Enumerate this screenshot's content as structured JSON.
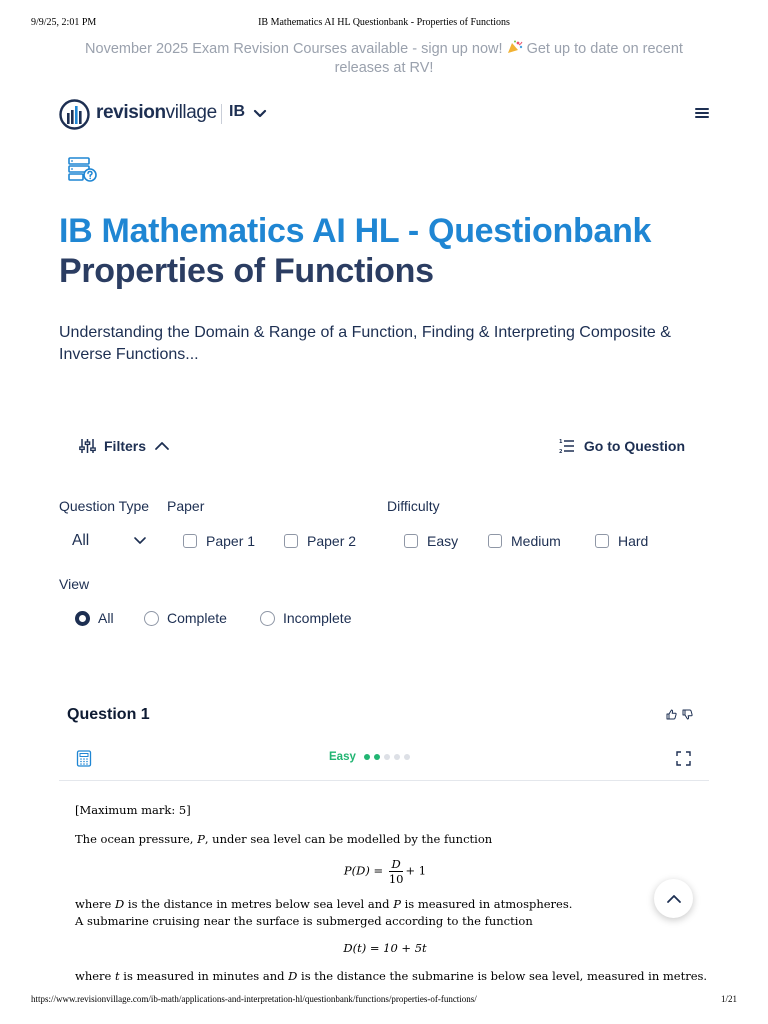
{
  "print": {
    "timestamp": "9/9/25, 2:01 PM",
    "page_title": "IB Mathematics AI HL Questionbank - Properties of Functions",
    "url": "https://www.revisionvillage.com/ib-math/applications-and-interpretation-hl/questionbank/functions/properties-of-functions/",
    "page_number": "1/21"
  },
  "announcement": {
    "text_before": "November 2025 Exam Revision Courses available - sign up now!",
    "emoji_icon": "party-popper-icon",
    "text_after": "Get up to date on recent releases at RV!"
  },
  "nav": {
    "logo_bold": "revision",
    "logo_light": "village",
    "curriculum": "IB",
    "menu_icon": "hamburger-menu-icon"
  },
  "hero": {
    "title_line1": "IB Mathematics AI HL - Questionbank",
    "title_line2": "Properties of Functions",
    "subtitle": "Understanding the Domain & Range of a Function, Finding & Interpreting Composite & Inverse Functions..."
  },
  "toolbar": {
    "filters_label": "Filters",
    "goto_label": "Go to Question"
  },
  "filters": {
    "question_type_label": "Question Type",
    "question_type_value": "All",
    "paper_label": "Paper",
    "paper_options": [
      "Paper 1",
      "Paper 2"
    ],
    "difficulty_label": "Difficulty",
    "difficulty_options": [
      "Easy",
      "Medium",
      "Hard"
    ],
    "view_label": "View",
    "view_options": [
      "All",
      "Complete",
      "Incomplete"
    ],
    "view_selected": "All"
  },
  "question": {
    "title": "Question 1",
    "difficulty_label": "Easy",
    "difficulty_level": 2,
    "difficulty_max": 5,
    "accent_color": "#22b573",
    "body": {
      "max_mark": "[Maximum mark: 5]",
      "intro_a": "The ocean pressure, ",
      "intro_var": "P",
      "intro_b": ", under sea level can be modelled by the function",
      "eq1_lhs": "P(D) = ",
      "eq1_num": "D",
      "eq1_den": "10",
      "eq1_rhs": "+ 1",
      "where1_a": "where ",
      "where1_var1": "D",
      "where1_b": " is the distance in metres below sea level and ",
      "where1_var2": "P",
      "where1_c": " is measured in atmospheres.",
      "sub_line": "A submarine cruising near the surface is submerged according to the function",
      "eq2": "D(t) = 10 + 5t",
      "where2_a": "where ",
      "where2_var1": "t",
      "where2_b": " is measured in minutes and ",
      "where2_var2": "D",
      "where2_c": " is the distance the submarine is below sea level, measured in metres."
    }
  },
  "colors": {
    "brand_blue": "#1f86d3",
    "navy": "#1d2f52",
    "muted_text": "#9aa1ad"
  }
}
